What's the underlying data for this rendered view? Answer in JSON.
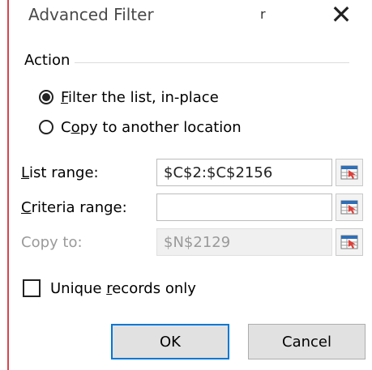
{
  "window": {
    "title": "Advanced Filter",
    "title_extra": "r",
    "close_glyph": "✕"
  },
  "action": {
    "label": "Action",
    "options": [
      {
        "pre": "",
        "acc": "F",
        "post": "ilter the list, in-place",
        "selected": true
      },
      {
        "pre": "C",
        "acc": "o",
        "post": "py to another location",
        "selected": false
      }
    ]
  },
  "fields": {
    "list_range": {
      "pre": "",
      "acc": "L",
      "post": "ist range:",
      "value": "$C$2:$C$2156",
      "enabled": true
    },
    "criteria_range": {
      "pre": "",
      "acc": "C",
      "post": "riteria range:",
      "value": "",
      "enabled": true
    },
    "copy_to": {
      "label": "Copy to:",
      "value": "$N$2129",
      "enabled": false
    }
  },
  "unique": {
    "pre": "Unique ",
    "acc": "r",
    "post": "ecords only",
    "checked": false
  },
  "buttons": {
    "ok": "OK",
    "cancel": "Cancel"
  },
  "colors": {
    "accent_border": "#0078d7",
    "window_edge": "#d9434f",
    "range_icon_red": "#e0403a",
    "range_icon_blue": "#2d6fb8"
  },
  "icons": {
    "range_selector": "collapse-dialog-icon"
  }
}
